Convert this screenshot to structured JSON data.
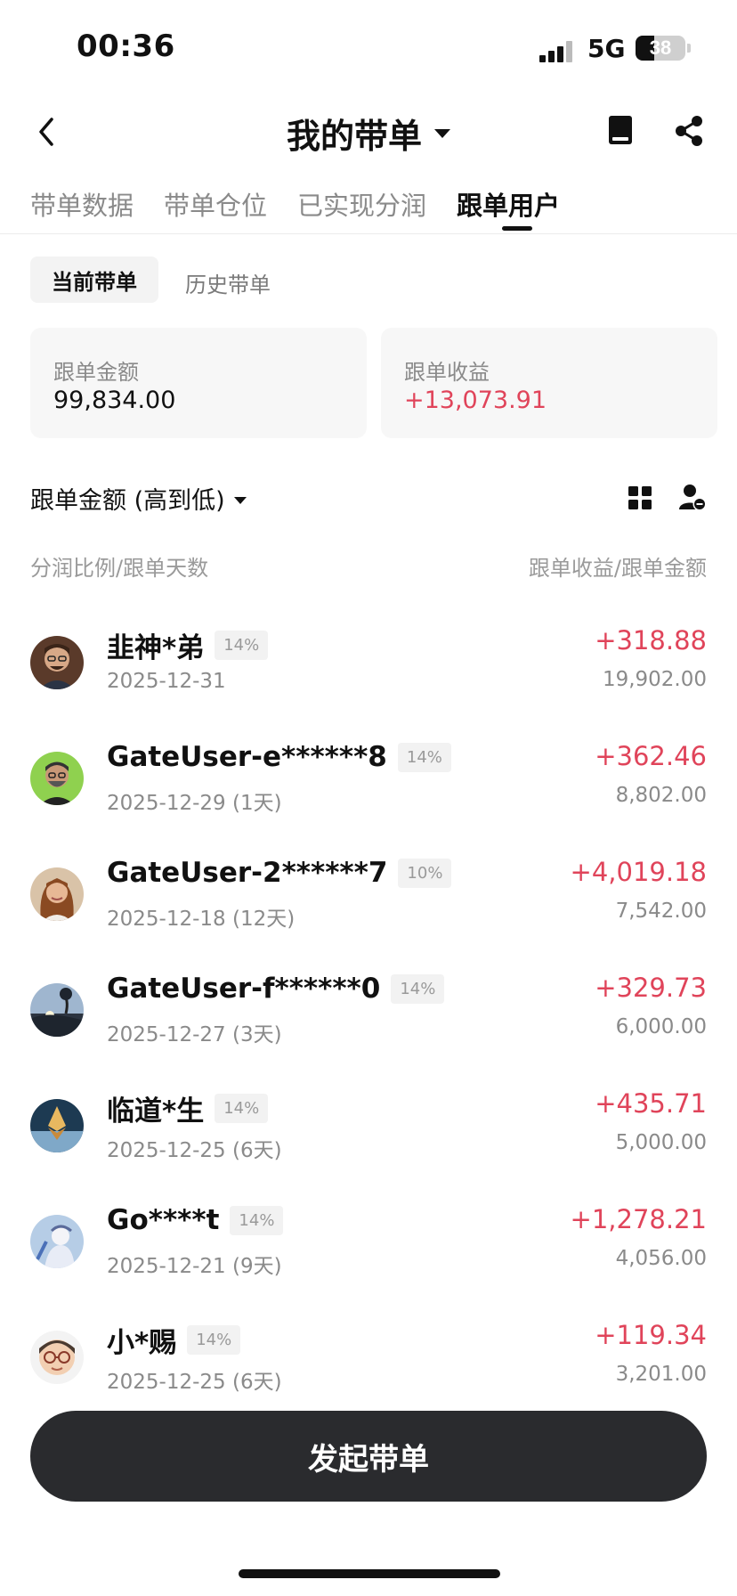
{
  "status_bar": {
    "time": "00:36",
    "network": "5G",
    "battery": "38"
  },
  "header": {
    "title": "我的带单"
  },
  "tabs": [
    {
      "label": "带单数据",
      "active": false
    },
    {
      "label": "带单仓位",
      "active": false
    },
    {
      "label": "已实现分润",
      "active": false
    },
    {
      "label": "跟单用户",
      "active": true
    }
  ],
  "subtabs": {
    "current": "当前带单",
    "history": "历史带单"
  },
  "summary": {
    "amount_label": "跟单金额",
    "amount_value": "99,834.00",
    "profit_label": "跟单收益",
    "profit_value": "+13,073.91"
  },
  "sort": {
    "label": "跟单金额 (高到低)"
  },
  "columns": {
    "left": "分润比例/跟单天数",
    "right": "跟单收益/跟单金额"
  },
  "users": [
    {
      "name": "韭神*弟",
      "pct": "14%",
      "date": "2025-12-31",
      "profit": "+318.88",
      "amount": "19,902.00"
    },
    {
      "name": "GateUser-e******8",
      "pct": "14%",
      "date": "2025-12-29 (1天)",
      "profit": "+362.46",
      "amount": "8,802.00"
    },
    {
      "name": "GateUser-2******7",
      "pct": "10%",
      "date": "2025-12-18 (12天)",
      "profit": "+4,019.18",
      "amount": "7,542.00"
    },
    {
      "name": "GateUser-f******0",
      "pct": "14%",
      "date": "2025-12-27 (3天)",
      "profit": "+329.73",
      "amount": "6,000.00"
    },
    {
      "name": "临道*生",
      "pct": "14%",
      "date": "2025-12-25 (6天)",
      "profit": "+435.71",
      "amount": "5,000.00"
    },
    {
      "name": "Go****t",
      "pct": "14%",
      "date": "2025-12-21 (9天)",
      "profit": "+1,278.21",
      "amount": "4,056.00"
    },
    {
      "name": "小*赐",
      "pct": "14%",
      "date": "2025-12-25 (6天)",
      "profit": "+119.34",
      "amount": "3,201.00"
    }
  ],
  "actions": {
    "launch": "发起带单"
  },
  "colors": {
    "profit_red": "#e0445a",
    "button_dark": "#2a2b2e"
  }
}
